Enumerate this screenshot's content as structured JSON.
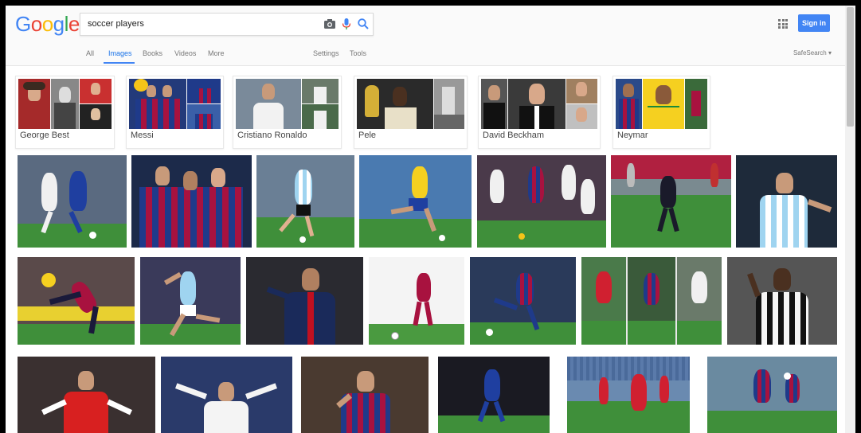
{
  "search": {
    "query": "soccer players"
  },
  "logo": {
    "letters": [
      "G",
      "o",
      "o",
      "g",
      "l",
      "e"
    ],
    "colors": [
      "#4285f4",
      "#ea4335",
      "#fbbc05",
      "#4285f4",
      "#34a853",
      "#ea4335"
    ]
  },
  "tabs": [
    {
      "label": "All"
    },
    {
      "label": "Images"
    },
    {
      "label": "Books"
    },
    {
      "label": "Videos"
    },
    {
      "label": "More"
    },
    {
      "label": "Settings"
    },
    {
      "label": "Tools"
    }
  ],
  "safesearch_label": "SafeSearch ▾",
  "signin_label": "Sign in",
  "related": [
    {
      "label": "George Best"
    },
    {
      "label": "Messi"
    },
    {
      "label": "Cristiano Ronaldo"
    },
    {
      "label": "Pele"
    },
    {
      "label": "David Beckham"
    },
    {
      "label": "Neymar"
    }
  ],
  "colors": {
    "accent": "#4285f4",
    "grass": "#3f8f3a",
    "barca_blue": "#1f3a8a",
    "barca_red": "#a8123f"
  }
}
